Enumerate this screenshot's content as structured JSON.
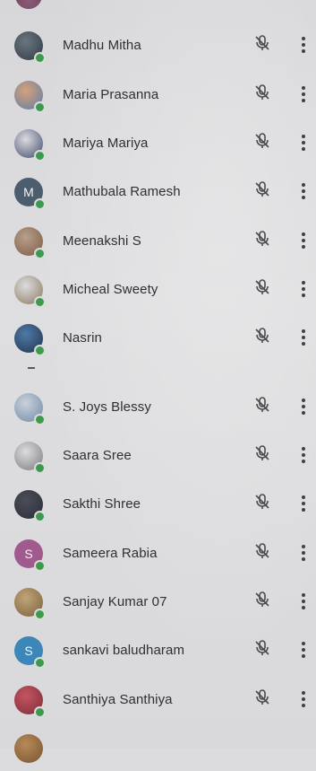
{
  "participants": [
    {
      "name": "Madhu Mitha",
      "avatar_letter": "",
      "avatar_colors": [
        "#6b7680",
        "#2f3a44"
      ]
    },
    {
      "name": "Maria Prasanna",
      "avatar_letter": "",
      "avatar_colors": [
        "#d6a07a",
        "#5c7ea8"
      ]
    },
    {
      "name": "Mariya Mariya",
      "avatar_letter": "",
      "avatar_colors": [
        "#dcdcdf",
        "#3f4a6e"
      ]
    },
    {
      "name": "Mathubala Ramesh",
      "avatar_letter": "M",
      "avatar_colors": [
        "#4c5d6e",
        "#3e4f60"
      ]
    },
    {
      "name": "Meenakshi S",
      "avatar_letter": "",
      "avatar_colors": [
        "#b8a08a",
        "#7c5a46"
      ]
    },
    {
      "name": "Micheal Sweety",
      "avatar_letter": "",
      "avatar_colors": [
        "#dcdcdf",
        "#8a7a5c"
      ]
    },
    {
      "name": "Nasrin",
      "avatar_letter": "",
      "avatar_colors": [
        "#4f79a8",
        "#23344b"
      ]
    },
    {
      "name": "S. Joys Blessy",
      "avatar_letter": "",
      "avatar_colors": [
        "#c9d2dc",
        "#6f8aa4"
      ]
    },
    {
      "name": "Saara Sree",
      "avatar_letter": "",
      "avatar_colors": [
        "#dcdcdf",
        "#7c7c80"
      ]
    },
    {
      "name": "Sakthi Shree",
      "avatar_letter": "",
      "avatar_colors": [
        "#4a4d57",
        "#2c2f38"
      ]
    },
    {
      "name": "Sameera Rabia",
      "avatar_letter": "S",
      "avatar_colors": [
        "#a15a8e",
        "#8e4a7c"
      ]
    },
    {
      "name": "Sanjay Kumar 07",
      "avatar_letter": "",
      "avatar_colors": [
        "#c0a57a",
        "#7b5f3a"
      ]
    },
    {
      "name": "sankavi baludharam",
      "avatar_letter": "S",
      "avatar_colors": [
        "#3c86b8",
        "#2f77a8"
      ]
    },
    {
      "name": "Santhiya Santhiya",
      "avatar_letter": "",
      "avatar_colors": [
        "#c45561",
        "#7a2e3a"
      ]
    }
  ],
  "icons": {
    "mic": "microphone-muted-icon",
    "more": "more-vert-icon",
    "status": "online-status-dot"
  },
  "colors": {
    "background": "#dcdcde",
    "text": "#2f2f33",
    "online": "#3d9a4d",
    "icon": "#4a4a4e"
  }
}
